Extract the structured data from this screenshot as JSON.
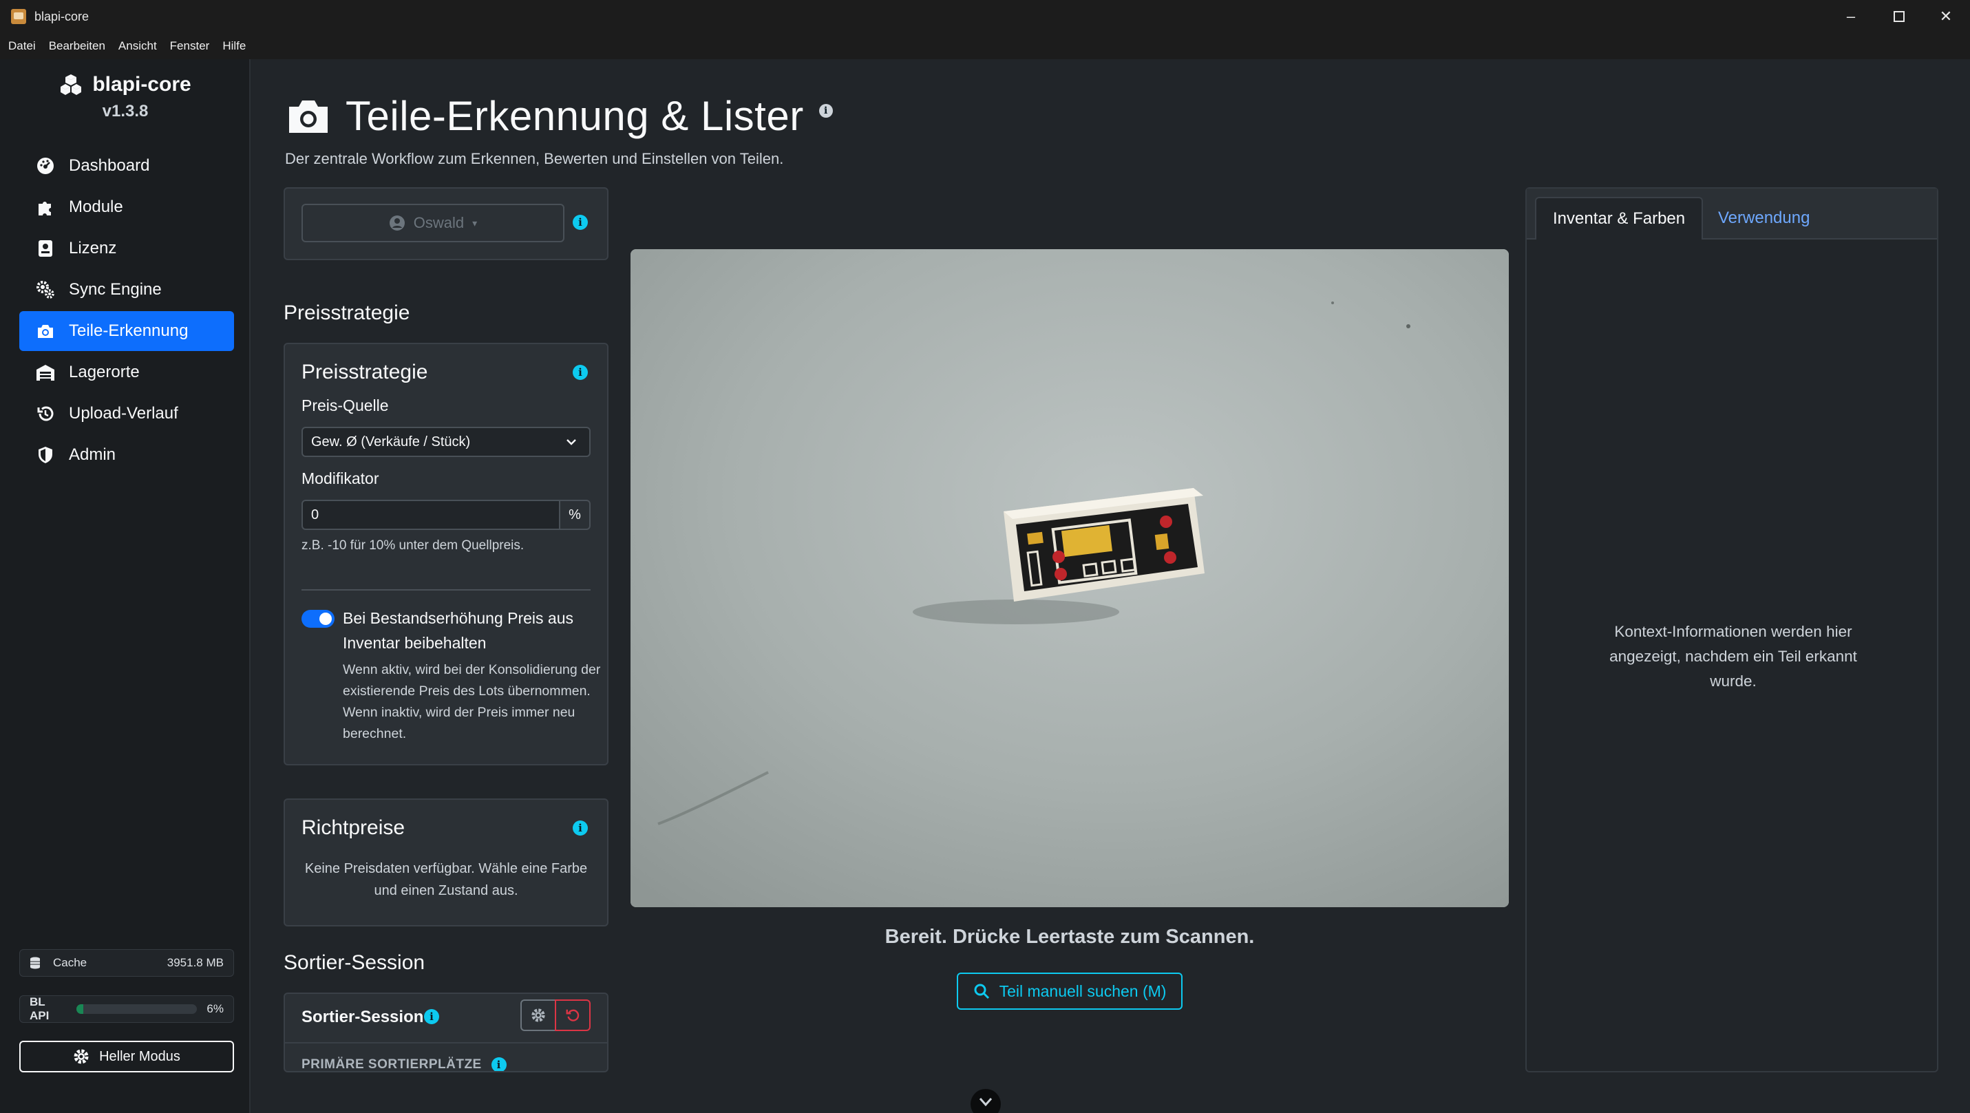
{
  "window": {
    "title": "blapi-core"
  },
  "menu": [
    "Datei",
    "Bearbeiten",
    "Ansicht",
    "Fenster",
    "Hilfe"
  ],
  "sidebar": {
    "brand": "blapi-core",
    "version": "v1.3.8",
    "items": [
      {
        "label": "Dashboard",
        "icon": "dashboard-icon"
      },
      {
        "label": "Module",
        "icon": "puzzle-icon"
      },
      {
        "label": "Lizenz",
        "icon": "license-icon"
      },
      {
        "label": "Sync Engine",
        "icon": "gears-icon"
      },
      {
        "label": "Teile-Erkennung",
        "icon": "camera-icon",
        "active": true
      },
      {
        "label": "Lagerorte",
        "icon": "warehouse-icon"
      },
      {
        "label": "Upload-Verlauf",
        "icon": "history-icon"
      },
      {
        "label": "Admin",
        "icon": "shield-icon"
      }
    ],
    "cache": {
      "label": "Cache",
      "value": "3951.8 MB"
    },
    "bl_api": {
      "label": "BL API",
      "value": "6%",
      "fraction": 0.06
    },
    "mode_button": "Heller Modus"
  },
  "page": {
    "title": "Teile-Erkennung & Lister",
    "subtitle": "Der zentrale Workflow zum Erkennen, Bewerten und Einstellen von Teilen."
  },
  "user": {
    "name": "Oswald"
  },
  "pricing": {
    "section_title": "Preisstrategie",
    "card_title": "Preisstrategie",
    "source_label": "Preis-Quelle",
    "source_value": "Gew. Ø (Verkäufe / Stück)",
    "modifier_label": "Modifikator",
    "modifier_value": "0",
    "modifier_unit": "%",
    "modifier_hint": "z.B. -10 für 10% unter dem Quellpreis.",
    "keep_price": {
      "enabled": true,
      "title": "Bei Bestandserhöhung Preis aus Inventar beibehalten",
      "description": "Wenn aktiv, wird bei der Konsolidierung der existierende Preis des Lots übernommen. Wenn inaktiv, wird der Preis immer neu berechnet."
    }
  },
  "guide_prices": {
    "title": "Richtpreise",
    "empty": "Keine Preisdaten verfügbar. Wähle eine Farbe und einen Zustand aus."
  },
  "sort_session": {
    "section_title": "Sortier-Session",
    "card_title": "Sortier-Session",
    "primary_label": "PRIMÄRE SORTIERPLÄTZE"
  },
  "scanner": {
    "status": "Bereit. Drücke Leertaste zum Scannen.",
    "manual_search": "Teil manuell suchen (M)"
  },
  "context": {
    "tabs": [
      "Inventar & Farben",
      "Verwendung"
    ],
    "empty": "Kontext-Informationen werden hier angezeigt, nachdem ein Teil erkannt wurde."
  },
  "colors": {
    "accent": "#0d6efd",
    "info": "#0dcaf0",
    "danger": "#dc3545",
    "success": "#198754"
  }
}
